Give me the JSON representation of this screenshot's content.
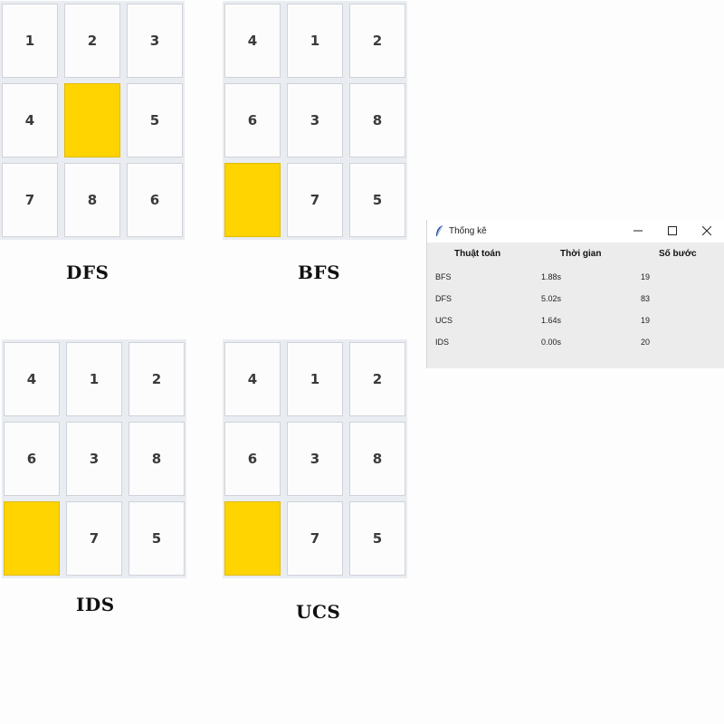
{
  "boards": [
    {
      "name": "DFS",
      "tiles": [
        "1",
        "2",
        "3",
        "4",
        "",
        "5",
        "7",
        "8",
        "6"
      ]
    },
    {
      "name": "BFS",
      "tiles": [
        "4",
        "1",
        "2",
        "6",
        "3",
        "8",
        "",
        "7",
        "5"
      ]
    },
    {
      "name": "IDS",
      "tiles": [
        "4",
        "1",
        "2",
        "6",
        "3",
        "8",
        "",
        "7",
        "5"
      ]
    },
    {
      "name": "UCS",
      "tiles": [
        "4",
        "1",
        "2",
        "6",
        "3",
        "8",
        "",
        "7",
        "5"
      ]
    }
  ],
  "stats_window": {
    "title": "Thống kê",
    "icons": {
      "app": "feather-icon",
      "minimize": "minimize-icon",
      "maximize": "maximize-icon",
      "close": "close-icon"
    },
    "headers": [
      "Thuật toán",
      "Thời gian",
      "Số bước"
    ],
    "rows": [
      [
        "BFS",
        "1.88s",
        "19"
      ],
      [
        "DFS",
        "5.02s",
        "83"
      ],
      [
        "UCS",
        "1.64s",
        "19"
      ],
      [
        "IDS",
        "0.00s",
        "20"
      ]
    ]
  },
  "colors": {
    "blank_tile": "#ffd400",
    "tile_bg": "#fcfcfc",
    "board_bg": "#e9ecf1"
  }
}
